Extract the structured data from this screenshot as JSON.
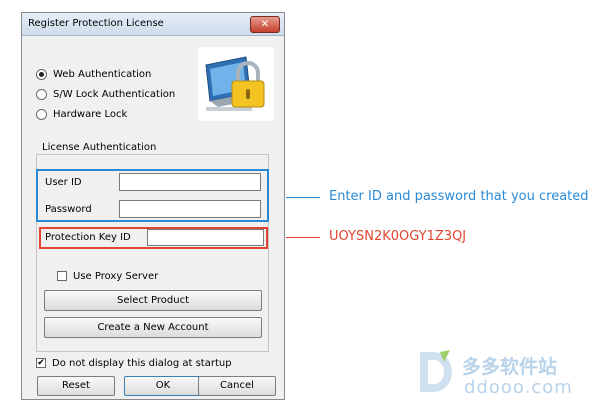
{
  "dialog": {
    "title": "Register Protection License",
    "close_glyph": "✕",
    "auth_options": [
      {
        "label": "Web Authentication",
        "selected": true
      },
      {
        "label": "S/W Lock Authentication",
        "selected": false
      },
      {
        "label": "Hardware Lock",
        "selected": false
      }
    ],
    "group_title": "License Authentication",
    "user_id_label": "User ID",
    "user_id_value": "",
    "password_label": "Password",
    "password_value": "",
    "protection_key_label": "Protection Key ID",
    "protection_key_value": "",
    "proxy": {
      "label": "Use Proxy Server",
      "checked": false
    },
    "select_product_label": "Select Product",
    "create_account_label": "Create a New Account",
    "startup": {
      "label": "Do not display this dialog at startup",
      "checked": true,
      "check_glyph": "✔"
    },
    "reset_label": "Reset",
    "ok_label": "OK",
    "cancel_label": "Cancel",
    "image_icon": "monitor-padlock-icon"
  },
  "callouts": {
    "credentials_note": "Enter ID and password that you created",
    "key_note": "UOYSN2K0OGY1Z3QJ",
    "blue": "#2a8ad6",
    "red": "#e2452f"
  },
  "watermark": {
    "brand_cn": "多多软件站",
    "url": "ddooo.com",
    "icon": "ddooo-logo-icon"
  }
}
